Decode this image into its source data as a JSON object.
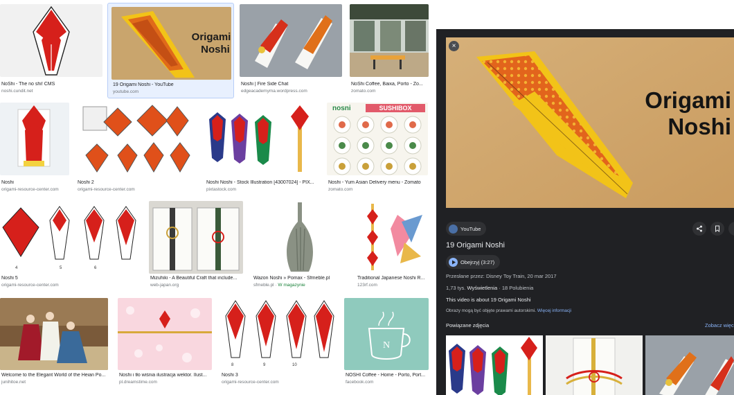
{
  "results": [
    {
      "caption": "NoShi - The no shi! CMS",
      "source": "noshi.cundit.net",
      "tag": ""
    },
    {
      "caption": "19 Origami Noshi - YouTube",
      "source": "youtube.com",
      "tag": ""
    },
    {
      "caption": "Noshi | Fire Side Chat",
      "source": "edgeacademyma.wordpress.com",
      "tag": ""
    },
    {
      "caption": "NoShi Coffee, Baixa, Porto - Zo...",
      "source": "zomato.com",
      "tag": ""
    },
    {
      "caption": "Noshi",
      "source": "origami-resource-center.com",
      "tag": ""
    },
    {
      "caption": "Noshi 2",
      "source": "origami-resource-center.com",
      "tag": ""
    },
    {
      "caption": "Noshi Noshi - Stock Illustration [43007024] - PIX...",
      "source": "pixtastock.com",
      "tag": ""
    },
    {
      "caption": "Noshi - Yum Asian Delivery menu - Zomato",
      "source": "zomato.com",
      "tag": ""
    },
    {
      "caption": "Noshi 5",
      "source": "origami-resource-center.com",
      "tag": ""
    },
    {
      "caption": "Mizuhiki - A Beautiful Craft that include...",
      "source": "web-japan.org",
      "tag": ""
    },
    {
      "caption": "Wazon Noshi » Pomax - Sfmeble.pl",
      "source": "sfmeble.pl",
      "tag": "W magazynie"
    },
    {
      "caption": "Traditional Japanese Noshi R...",
      "source": "123rf.com",
      "tag": ""
    },
    {
      "caption": "Welcome to the Elegant World of the Heian Po...",
      "source": "junihitoe.net",
      "tag": ""
    },
    {
      "caption": "Noshi i tło wiśnia ilustracja wektor. Ilust...",
      "source": "pl.dreamstime.com",
      "tag": ""
    },
    {
      "caption": "Noshi 3",
      "source": "origami-resource-center.com",
      "tag": ""
    },
    {
      "caption": "NOSHI Coffee - Home - Porto, Port...",
      "source": "facebook.com",
      "tag": ""
    }
  ],
  "thumb_text": {
    "origami_line1": "Origami",
    "origami_line2": "Noshi",
    "sushi_brand": "nosni",
    "sushi_box": "SUSHIBOX",
    "step_4": "4",
    "step_5": "5",
    "step_6": "6",
    "step_8": "8",
    "step_9": "9",
    "step_10": "10"
  },
  "preview": {
    "close_label": "×",
    "hero_line1": "Origami",
    "hero_line2": "Noshi",
    "site_name": "YouTube",
    "title": "19 Origami Noshi",
    "watch_label": "Obejrzyj (3:27)",
    "uploaded_by": "Przesłane przez: Disney Toy Train, 20 mar 2017",
    "views_count": "1,73 tys.",
    "views_label": "Wyświetlenia",
    "likes": "· 18 Polubienia",
    "description": "This video is about 19 Origami Noshi",
    "copyright": "Obrazy mogą być objęte prawami autorskimi.",
    "more_info": "Więcej informacji",
    "related_label": "Powiązane zdjęcia",
    "see_more": "Zobacz więcej"
  },
  "colors": {
    "panel_bg": "#202124",
    "link": "#8ab4f8",
    "noshi_red": "#d6201b",
    "origami_yellow": "#f2c318",
    "origami_orange": "#e06a1a"
  }
}
